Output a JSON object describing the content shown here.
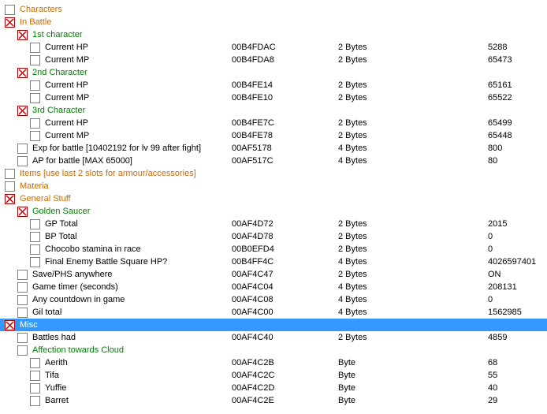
{
  "columns": {
    "addr_header": "",
    "type_header": "",
    "val_header": ""
  },
  "rows": [
    {
      "indent": 0,
      "sel": false,
      "cls": "orange",
      "desc": "Characters"
    },
    {
      "indent": 0,
      "sel": true,
      "cls": "orange",
      "desc": "In Battle"
    },
    {
      "indent": 1,
      "sel": true,
      "cls": "green",
      "desc": "1st character"
    },
    {
      "indent": 2,
      "sel": false,
      "cls": "",
      "desc": "Current HP",
      "addr": "00B4FDAC",
      "type": "2 Bytes",
      "val": "5288"
    },
    {
      "indent": 2,
      "sel": false,
      "cls": "",
      "desc": "Current MP",
      "addr": "00B4FDA8",
      "type": "2 Bytes",
      "val": "65473"
    },
    {
      "indent": 1,
      "sel": true,
      "cls": "green",
      "desc": "2nd Character"
    },
    {
      "indent": 2,
      "sel": false,
      "cls": "",
      "desc": "Current HP",
      "addr": "00B4FE14",
      "type": "2 Bytes",
      "val": "65161"
    },
    {
      "indent": 2,
      "sel": false,
      "cls": "",
      "desc": "Current MP",
      "addr": "00B4FE10",
      "type": "2 Bytes",
      "val": "65522"
    },
    {
      "indent": 1,
      "sel": true,
      "cls": "green",
      "desc": "3rd Character"
    },
    {
      "indent": 2,
      "sel": false,
      "cls": "",
      "desc": "Current HP",
      "addr": "00B4FE7C",
      "type": "2 Bytes",
      "val": "65499"
    },
    {
      "indent": 2,
      "sel": false,
      "cls": "",
      "desc": "Current MP",
      "addr": "00B4FE78",
      "type": "2 Bytes",
      "val": "65448"
    },
    {
      "indent": 1,
      "sel": false,
      "cls": "",
      "desc": "Exp for battle [10402192 for lv 99 after fight]",
      "addr": "00AF5178",
      "type": "4 Bytes",
      "val": "800"
    },
    {
      "indent": 1,
      "sel": false,
      "cls": "",
      "desc": "AP for battle [MAX 65000]",
      "addr": "00AF517C",
      "type": "4 Bytes",
      "val": "80"
    },
    {
      "indent": 0,
      "sel": false,
      "cls": "orange",
      "desc": "Items [use last 2 slots for armour/accessories]"
    },
    {
      "indent": 0,
      "sel": false,
      "cls": "orange",
      "desc": "Materia"
    },
    {
      "indent": 0,
      "sel": true,
      "cls": "orange",
      "desc": "General Stuff"
    },
    {
      "indent": 1,
      "sel": true,
      "cls": "green",
      "desc": "Golden Saucer"
    },
    {
      "indent": 2,
      "sel": false,
      "cls": "",
      "desc": "GP Total",
      "addr": "00AF4D72",
      "type": "2 Bytes",
      "val": "2015"
    },
    {
      "indent": 2,
      "sel": false,
      "cls": "",
      "desc": "BP Total",
      "addr": "00AF4D78",
      "type": "2 Bytes",
      "val": "0"
    },
    {
      "indent": 2,
      "sel": false,
      "cls": "",
      "desc": "Chocobo stamina in race",
      "addr": "00B0EFD4",
      "type": "2 Bytes",
      "val": "0"
    },
    {
      "indent": 2,
      "sel": false,
      "cls": "",
      "desc": "Final Enemy Battle Square HP?",
      "addr": "00B4FF4C",
      "type": "4 Bytes",
      "val": "4026597401"
    },
    {
      "indent": 1,
      "sel": false,
      "cls": "",
      "desc": "Save/PHS anywhere",
      "addr": "00AF4C47",
      "type": "2 Bytes",
      "val": "ON"
    },
    {
      "indent": 1,
      "sel": false,
      "cls": "",
      "desc": "Game timer (seconds)",
      "addr": "00AF4C04",
      "type": "4 Bytes",
      "val": "208131"
    },
    {
      "indent": 1,
      "sel": false,
      "cls": "",
      "desc": "Any countdown in game",
      "addr": "00AF4C08",
      "type": "4 Bytes",
      "val": "0"
    },
    {
      "indent": 1,
      "sel": false,
      "cls": "",
      "desc": "Gil total",
      "addr": "00AF4C00",
      "type": "4 Bytes",
      "val": "1562985"
    },
    {
      "indent": 0,
      "sel": true,
      "cls": "orange",
      "desc": "Misc",
      "highlight": true
    },
    {
      "indent": 1,
      "sel": false,
      "cls": "",
      "desc": "Battles had",
      "addr": "00AF4C40",
      "type": "2 Bytes",
      "val": "4859"
    },
    {
      "indent": 1,
      "sel": false,
      "cls": "green",
      "desc": "Affection towards Cloud"
    },
    {
      "indent": 2,
      "sel": false,
      "cls": "",
      "desc": "Aerith",
      "addr": "00AF4C2B",
      "type": "Byte",
      "val": "68"
    },
    {
      "indent": 2,
      "sel": false,
      "cls": "",
      "desc": "Tifa",
      "addr": "00AF4C2C",
      "type": "Byte",
      "val": "55"
    },
    {
      "indent": 2,
      "sel": false,
      "cls": "",
      "desc": "Yuffie",
      "addr": "00AF4C2D",
      "type": "Byte",
      "val": "40"
    },
    {
      "indent": 2,
      "sel": false,
      "cls": "",
      "desc": "Barret",
      "addr": "00AF4C2E",
      "type": "Byte",
      "val": "29"
    }
  ]
}
